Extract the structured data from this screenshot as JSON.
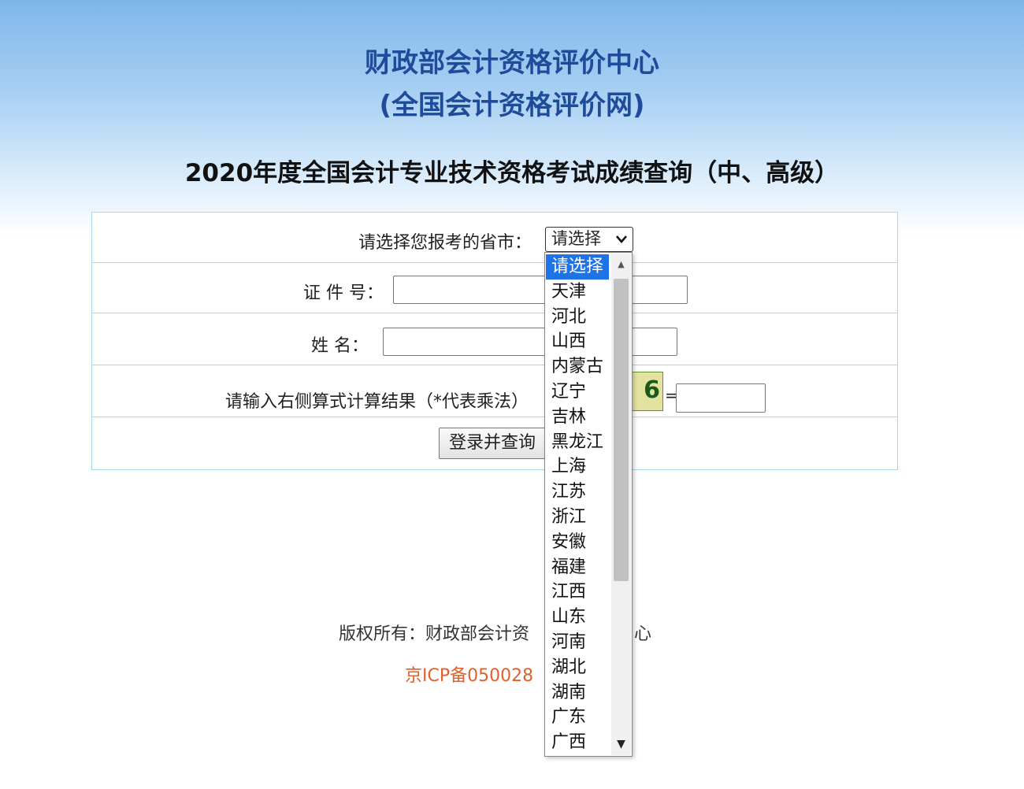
{
  "header": {
    "title_line1": "财政部会计资格评价中心",
    "title_line2": "(全国会计资格评价网)",
    "exam_title": "2020年度全国会计专业技术资格考试成绩查询（中、高级）"
  },
  "form": {
    "province_label": "请选择您报考的省市：",
    "province_selected": "请选择",
    "id_label": "证 件 号：",
    "name_label": "姓   名：",
    "calc_label": "请输入右侧算式计算结果（*代表乘法）",
    "captcha_visible_text": "6",
    "equals": "=",
    "submit_label": "登录并查询"
  },
  "footer": {
    "copyright_prefix": "版权所有：财政部会计资",
    "copyright_suffix": "心",
    "icp": "京ICP备050028"
  },
  "dropdown": {
    "options": [
      "请选择",
      "天津",
      "河北",
      "山西",
      "内蒙古",
      "辽宁",
      "吉林",
      "黑龙江",
      "上海",
      "江苏",
      "浙江",
      "安徽",
      "福建",
      "江西",
      "山东",
      "河南",
      "湖北",
      "湖南",
      "广东",
      "广西"
    ],
    "selected_index": 0
  },
  "colors": {
    "title_blue": "#1f4c9a",
    "selected_option": "#1e73e8",
    "icp_orange": "#e2602a",
    "border": "#a8d6ee"
  }
}
